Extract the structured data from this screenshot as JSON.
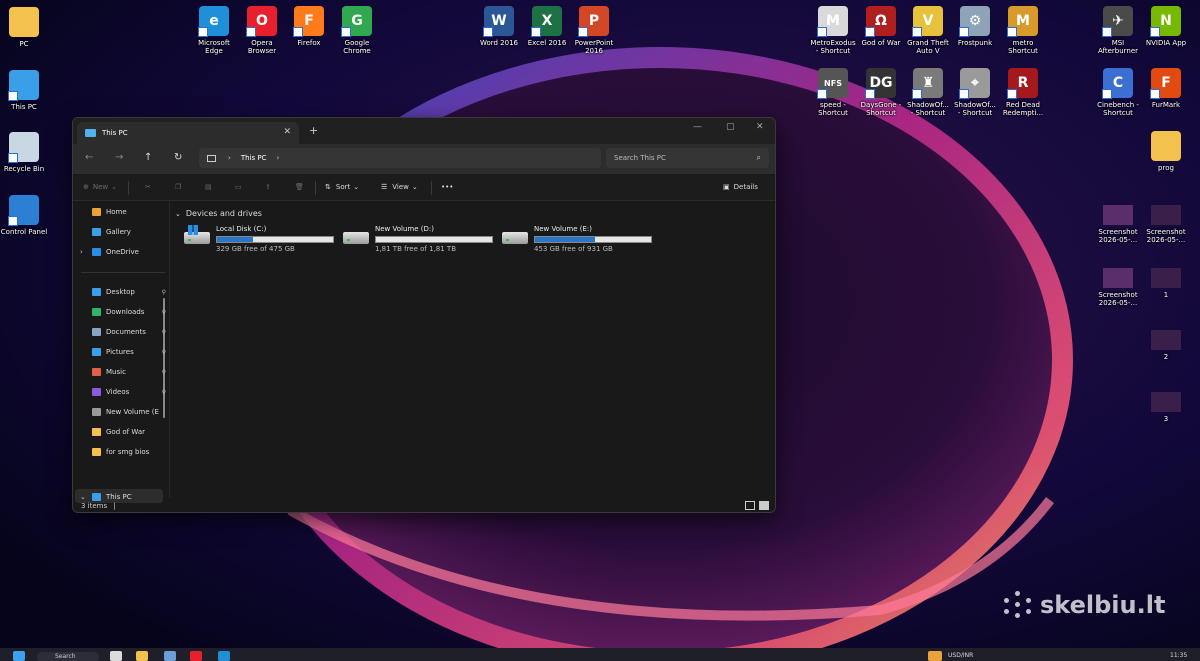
{
  "desktop": {
    "left_icons": [
      {
        "label": "PC",
        "icon": "folder-icon",
        "color": "#f2c14e"
      },
      {
        "label": "This PC",
        "icon": "monitor-icon",
        "color": "#3a9ee8"
      },
      {
        "label": "Recycle Bin",
        "icon": "recycle-bin-icon",
        "color": "#c9d6e3"
      },
      {
        "label": "Control Panel",
        "icon": "control-panel-icon",
        "color": "#2d7fd3"
      }
    ],
    "top_icons": [
      {
        "label": "Microsoft\nEdge",
        "icon": "edge-icon",
        "color": "#1f8fd8",
        "glyph": "e"
      },
      {
        "label": "Opera\nBrowser",
        "icon": "opera-icon",
        "color": "#e8202e",
        "glyph": "O"
      },
      {
        "label": "Firefox",
        "icon": "firefox-icon",
        "color": "#ff7a1a",
        "glyph": "F"
      },
      {
        "label": "Google\nChrome",
        "icon": "chrome-icon",
        "color": "#2fa84f",
        "glyph": "G"
      },
      {
        "label": "Word 2016",
        "icon": "word-icon",
        "color": "#2b5797",
        "glyph": "W"
      },
      {
        "label": "Excel 2016",
        "icon": "excel-icon",
        "color": "#1e7145",
        "glyph": "X"
      },
      {
        "label": "PowerPoint\n2016",
        "icon": "powerpoint-icon",
        "color": "#d24726",
        "glyph": "P"
      }
    ],
    "right_icons": [
      {
        "label": "MetroExodus\n- Shortcut",
        "icon": "metro-exodus-icon",
        "color": "#d9d9d9",
        "glyph": "M"
      },
      {
        "label": "God of War",
        "icon": "god-of-war-icon",
        "color": "#b01e1e",
        "glyph": "Ω"
      },
      {
        "label": "Grand Theft\nAuto V",
        "icon": "gta-icon",
        "color": "#e7c13a",
        "glyph": "V"
      },
      {
        "label": "Frostpunk",
        "icon": "frostpunk-icon",
        "color": "#8ea3b8",
        "glyph": "⚙"
      },
      {
        "label": "metro\nShortcut",
        "icon": "metro-icon",
        "color": "#d89a2a",
        "glyph": "M"
      },
      {
        "label": "MSI\nAfterburner",
        "icon": "msi-afterburner-icon",
        "color": "#4a4a4a",
        "glyph": "✈"
      },
      {
        "label": "NVIDIA App",
        "icon": "nvidia-icon",
        "color": "#76b900",
        "glyph": "N"
      },
      {
        "label": "speed -\nShortcut",
        "icon": "nfs-icon",
        "color": "#555555",
        "glyph": "NFS"
      },
      {
        "label": "DaysGone -\nShortcut",
        "icon": "days-gone-icon",
        "color": "#333333",
        "glyph": "DG"
      },
      {
        "label": "ShadowOf...\n- Shortcut",
        "icon": "shadow-of-tomb-raider-icon",
        "color": "#7a7a7a",
        "glyph": "♜"
      },
      {
        "label": "ShadowOf...\n- Shortcut",
        "icon": "shadow-of-war-icon",
        "color": "#9a9a9a",
        "glyph": "⌖"
      },
      {
        "label": "Red Dead\nRedempti...",
        "icon": "red-dead-icon",
        "color": "#a5181c",
        "glyph": "R"
      },
      {
        "label": "Cinebench -\nShortcut",
        "icon": "cinebench-icon",
        "color": "#3b6fd1",
        "glyph": "C"
      },
      {
        "label": "FurMark",
        "icon": "furmark-icon",
        "color": "#e34a12",
        "glyph": "F"
      },
      {
        "label": "prog",
        "icon": "folder-icon",
        "color": "#f2c14e",
        "glyph": ""
      },
      {
        "label": "Screenshot\n2026-05-...",
        "icon": "screenshot-thumb-icon",
        "color": "#5a2e6a",
        "glyph": ""
      },
      {
        "label": "Screenshot\n2026-05-...",
        "icon": "screenshot-thumb-icon",
        "color": "#3a1f4a",
        "glyph": ""
      },
      {
        "label": "Screenshot\n2026-05-...",
        "icon": "screenshot-thumb-icon",
        "color": "#5a2e6a",
        "glyph": ""
      },
      {
        "label": "1",
        "icon": "image-thumb-icon",
        "color": "#3a1f4a",
        "glyph": ""
      },
      {
        "label": "2",
        "icon": "image-thumb-icon",
        "color": "#3a1f4a",
        "glyph": ""
      },
      {
        "label": "3",
        "icon": "image-thumb-icon",
        "color": "#3a1f4a",
        "glyph": ""
      }
    ]
  },
  "explorer": {
    "tab_title": "This PC",
    "tab_close": "✕",
    "new_tab": "+",
    "window_buttons": {
      "minimize": "—",
      "maximize": "▢",
      "close": "✕"
    },
    "nav": {
      "back": "←",
      "forward": "→",
      "up": "↑",
      "refresh": "↻"
    },
    "address": {
      "chevron": "›",
      "path": "This PC",
      "chevron2": "›"
    },
    "search": {
      "placeholder": "Search This PC",
      "icon": "⌕"
    },
    "toolbar": {
      "new_label": "New",
      "sort_label": "Sort",
      "view_label": "View",
      "more_label": "•••",
      "details_label": "Details",
      "dropdown": "⌄"
    },
    "sidebar": {
      "items": [
        {
          "label": "Home",
          "icon": "home-icon",
          "color": "#e8a33a"
        },
        {
          "label": "Gallery",
          "icon": "gallery-icon",
          "color": "#3a9ee8"
        },
        {
          "label": "OneDrive",
          "icon": "onedrive-icon",
          "color": "#2a8ee8"
        },
        {
          "label": "Desktop",
          "icon": "desktop-icon",
          "color": "#3a9ee8"
        },
        {
          "label": "Downloads",
          "icon": "downloads-icon",
          "color": "#2fb36a"
        },
        {
          "label": "Documents",
          "icon": "documents-icon",
          "color": "#8aa4c8"
        },
        {
          "label": "Pictures",
          "icon": "pictures-icon",
          "color": "#3a9ee8"
        },
        {
          "label": "Music",
          "icon": "music-icon",
          "color": "#e0604a"
        },
        {
          "label": "Videos",
          "icon": "videos-icon",
          "color": "#8a5ae0"
        },
        {
          "label": "New Volume (E",
          "icon": "drive-icon",
          "color": "#9a9a9a"
        },
        {
          "label": "God of War",
          "icon": "folder-icon",
          "color": "#f2c14e"
        },
        {
          "label": "for smg bios",
          "icon": "folder-icon",
          "color": "#f2c14e"
        },
        {
          "label": "This PC",
          "icon": "this-pc-icon",
          "color": "#3a9ee8"
        }
      ],
      "pin": "📌",
      "expand": "›",
      "expand_down": "⌄"
    },
    "group_title": "Devices and drives",
    "group_chevron": "⌄",
    "drives": [
      {
        "name": "Local Disk (C:)",
        "free_text": "329 GB free of 475 GB",
        "used_fraction": 0.307,
        "system": true
      },
      {
        "name": "New Volume (D:)",
        "free_text": "1,81 TB free of 1,81 TB",
        "used_fraction": 0.0,
        "system": false
      },
      {
        "name": "New Volume (E:)",
        "free_text": "453 GB free of 931 GB",
        "used_fraction": 0.513,
        "system": false
      }
    ],
    "status": "3 items",
    "status_cursor": "|"
  },
  "taskbar": {
    "search_label": "Search",
    "currency": "USD/INR",
    "time": "11:35"
  },
  "watermark": "skelbiu.lt"
}
